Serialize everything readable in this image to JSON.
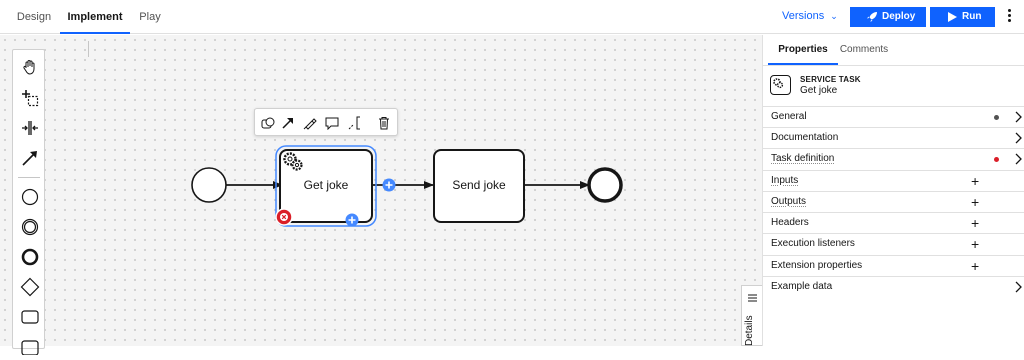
{
  "top_tabs": [
    {
      "label": "Design"
    },
    {
      "label": "Implement"
    },
    {
      "label": "Play"
    }
  ],
  "versions": {
    "label": "Versions"
  },
  "deploy_button": {
    "label": "Deploy"
  },
  "run_button": {
    "label": "Run"
  },
  "context_pad": {
    "items": [
      "change-type-icon",
      "connect-arrow-icon",
      "color-picker-icon",
      "comment-icon",
      "annotation-icon",
      "delete-icon"
    ]
  },
  "palette": {
    "items": [
      "hand-tool-icon",
      "lasso-tool-icon",
      "space-tool-icon",
      "global-connect-icon",
      "start-event-icon",
      "intermediate-event-icon",
      "end-event-icon",
      "gateway-icon",
      "task-icon",
      "subprocess-icon"
    ]
  },
  "diagram": {
    "task_1": "Get joke",
    "task_2": "Send joke"
  },
  "details_tab": {
    "label": "Details"
  },
  "panel": {
    "tabs": [
      {
        "label": "Properties"
      },
      {
        "label": "Comments"
      }
    ],
    "element_type": "SERVICE TASK",
    "element_name": "Get joke",
    "groups": [
      {
        "label": "General",
        "indicator": "dot",
        "indicator_color": "#525252",
        "action": "chevron"
      },
      {
        "label": "Documentation",
        "action": "chevron"
      },
      {
        "label": "Task definition",
        "indicator": "dot",
        "indicator_color": "#da1e28",
        "action": "chevron"
      },
      {
        "label": "Inputs",
        "action": "plus"
      },
      {
        "label": "Outputs",
        "action": "plus"
      },
      {
        "label": "Headers",
        "action": "plus"
      },
      {
        "label": "Execution listeners",
        "action": "plus"
      },
      {
        "label": "Extension properties",
        "action": "plus"
      },
      {
        "label": "Example data",
        "action": "chevron"
      }
    ],
    "plus_symbol": "+"
  },
  "colors": {
    "accent": "#0f62fe",
    "error": "#da1e28",
    "selection": "#4589ff"
  }
}
